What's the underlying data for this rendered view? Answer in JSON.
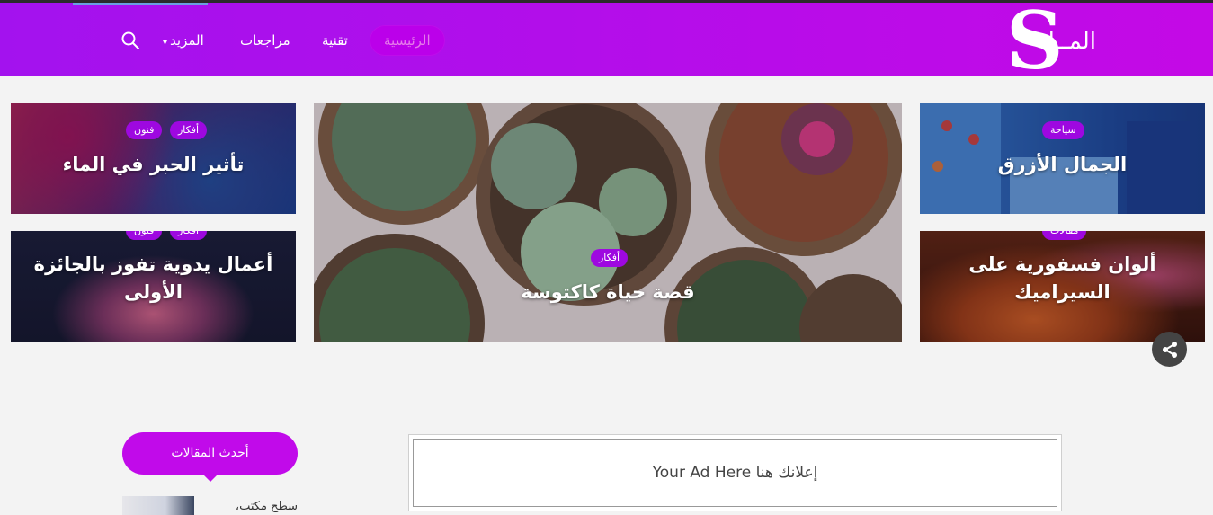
{
  "header": {
    "logo_text": "المــلة",
    "logo_glyph": "S",
    "nav": {
      "home": "الرئيسية",
      "tech": "تقنية",
      "reviews": "مراجعات",
      "more": "المزيد"
    }
  },
  "tiles": {
    "ink": {
      "title": "تأثير الحبر في الماء",
      "tags": [
        "أفكار",
        "فنون"
      ]
    },
    "crafts": {
      "title_line1": "أعمال يدوية تفوز بالجائزة",
      "title_line2": "الأولى",
      "tags": [
        "أفكار",
        "فنون"
      ]
    },
    "cactus": {
      "title": "قصة حياة كاكتوسة",
      "tag": "أفكار"
    },
    "blue": {
      "title": "الجمال الأزرق",
      "tag": "سياحة"
    },
    "ceramics": {
      "title_line1": "ألوان فسفورية على",
      "title_line2": "السيراميك",
      "tag": "مقالات"
    }
  },
  "sidebar": {
    "latest_label": "أحدث المقالات",
    "latest_item": "سطح مكتب،"
  },
  "ad": {
    "text": "Your Ad Here  إعلانك هنا"
  },
  "colors": {
    "brand": "#bb00ea",
    "tag": "#9e08e0"
  }
}
